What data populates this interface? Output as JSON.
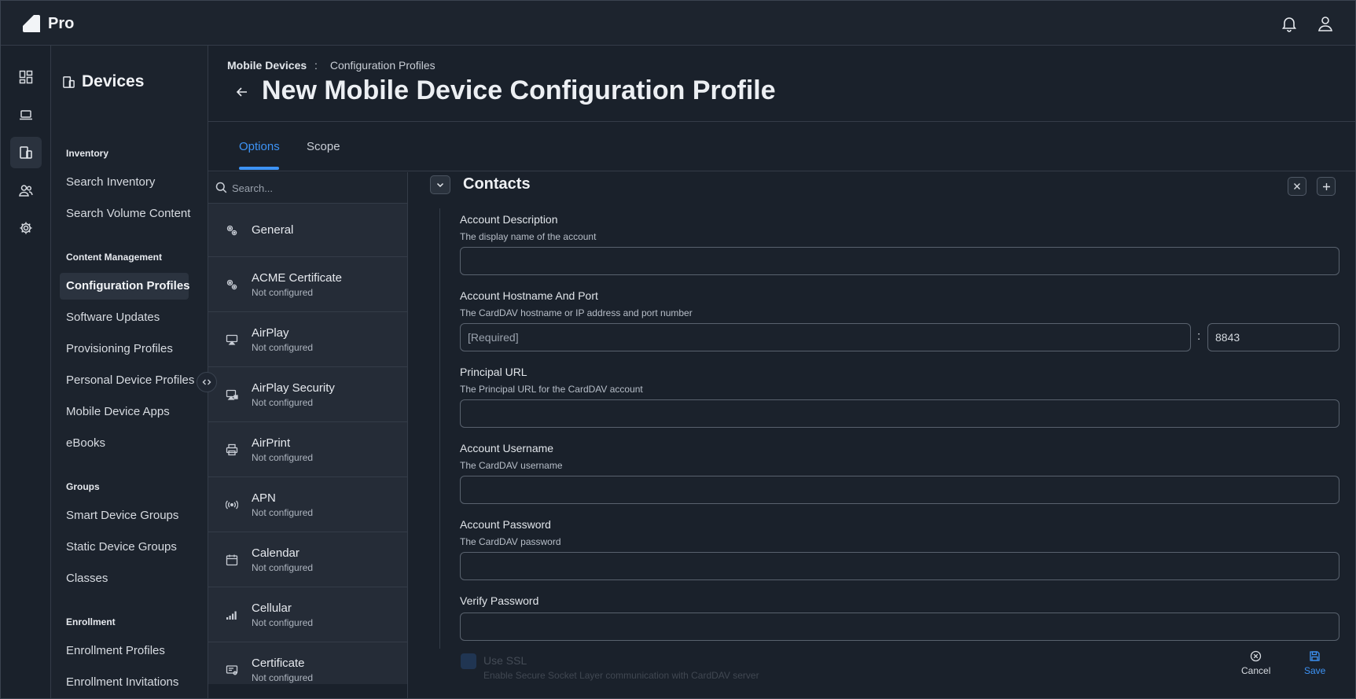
{
  "app": {
    "brand": "Pro"
  },
  "nav": {
    "title": "Devices",
    "sections": [
      {
        "heading": "Inventory",
        "items": [
          "Search Inventory",
          "Search Volume Content"
        ]
      },
      {
        "heading": "Content Management",
        "items": [
          "Configuration Profiles",
          "Software Updates",
          "Provisioning Profiles",
          "Personal Device Profiles",
          "Mobile Device Apps",
          "eBooks"
        ]
      },
      {
        "heading": "Groups",
        "items": [
          "Smart Device Groups",
          "Static Device Groups",
          "Classes"
        ]
      },
      {
        "heading": "Enrollment",
        "items": [
          "Enrollment Profiles",
          "Enrollment Invitations"
        ]
      }
    ],
    "active_item": "Configuration Profiles"
  },
  "breadcrumb": {
    "parent": "Mobile Devices",
    "separator": ":",
    "current": "Configuration Profiles"
  },
  "page": {
    "title": "New Mobile Device Configuration Profile"
  },
  "tabs": [
    {
      "label": "Options",
      "active": true
    },
    {
      "label": "Scope",
      "active": false
    }
  ],
  "payloads": {
    "search_placeholder": "Search...",
    "items": [
      {
        "name": "General",
        "status": "",
        "icon": "gears-icon"
      },
      {
        "name": "ACME Certificate",
        "status": "Not configured",
        "icon": "gears-icon"
      },
      {
        "name": "AirPlay",
        "status": "Not configured",
        "icon": "airplay-icon"
      },
      {
        "name": "AirPlay Security",
        "status": "Not configured",
        "icon": "airplay-security-icon"
      },
      {
        "name": "AirPrint",
        "status": "Not configured",
        "icon": "printer-icon"
      },
      {
        "name": "APN",
        "status": "Not configured",
        "icon": "antenna-icon"
      },
      {
        "name": "Calendar",
        "status": "Not configured",
        "icon": "calendar-icon"
      },
      {
        "name": "Cellular",
        "status": "Not configured",
        "icon": "signal-bars-icon"
      },
      {
        "name": "Certificate",
        "status": "Not configured",
        "icon": "certificate-icon"
      }
    ]
  },
  "section": {
    "title": "Contacts",
    "fields": {
      "account_description": {
        "label": "Account Description",
        "desc": "The display name of the account",
        "value": ""
      },
      "hostname_port": {
        "label": "Account Hostname And Port",
        "desc": "The CardDAV hostname or IP address and port number",
        "placeholder": "[Required]",
        "port": "8843",
        "separator": ":"
      },
      "principal_url": {
        "label": "Principal URL",
        "desc": "The Principal URL for the CardDAV account",
        "value": ""
      },
      "username": {
        "label": "Account Username",
        "desc": "The CardDAV username",
        "value": ""
      },
      "password": {
        "label": "Account Password",
        "desc": "The CardDAV password",
        "value": ""
      },
      "verify_password": {
        "label": "Verify Password",
        "value": ""
      },
      "use_ssl": {
        "label": "Use SSL",
        "desc": "Enable Secure Socket Layer communication with CardDAV server"
      }
    }
  },
  "actions": {
    "cancel": "Cancel",
    "save": "Save"
  },
  "colors": {
    "accent": "#3d93f5",
    "background": "#1a212b"
  }
}
